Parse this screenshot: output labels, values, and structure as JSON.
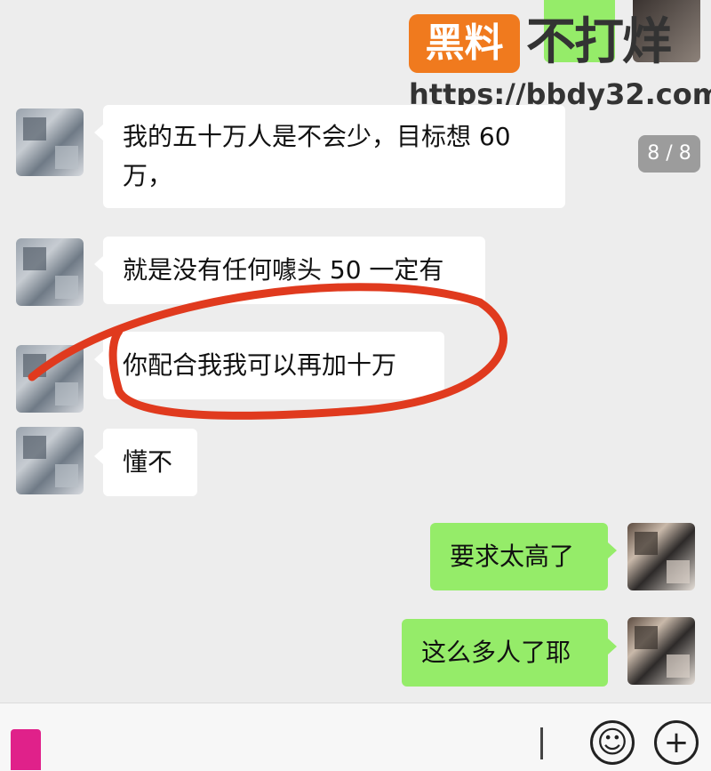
{
  "watermark": {
    "logo": "黑料",
    "title": "不打烊",
    "url": "https://bbdy32.com"
  },
  "image_counter": "8 / 8",
  "messages": [
    {
      "side": "left",
      "text_line1": "我的五十万人是不会少，目标想 60",
      "text_line2": "万，"
    },
    {
      "side": "left",
      "text": "就是没有任何噱头 50 一定有"
    },
    {
      "side": "left",
      "text": "你配合我我可以再加十万"
    },
    {
      "side": "left",
      "text": "懂不"
    },
    {
      "side": "right",
      "text": "要求太高了"
    },
    {
      "side": "right",
      "text": "这么多人了耶"
    }
  ],
  "input_bar": {
    "emoji_icon": "☺",
    "plus_icon": "+"
  },
  "colors": {
    "bubble_sent": "#95ec69",
    "bubble_received": "#ffffff",
    "annotation": "#e03a1e"
  }
}
